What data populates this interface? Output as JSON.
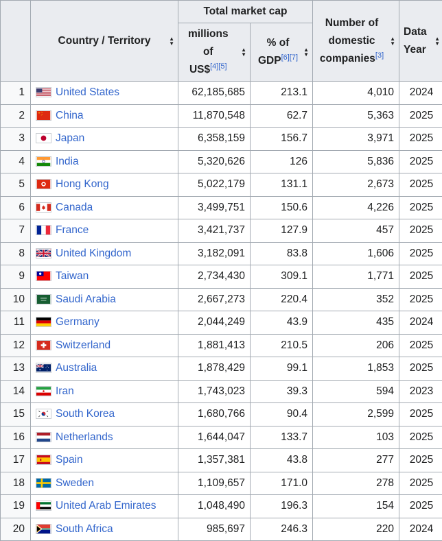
{
  "header": {
    "country": "Country / Territory",
    "market_cap_group": "Total market cap",
    "millions_line1": "millions",
    "millions_line2": "of",
    "millions_line3": "US$",
    "millions_refs": "[4][5]",
    "gdp_line1": "% of",
    "gdp_line2": "GDP",
    "gdp_refs": "[6][7]",
    "companies_line1": "Number of",
    "companies_line2": "domestic",
    "companies_line3": "companies",
    "companies_refs": "[3]",
    "year_line1": "Data",
    "year_line2": "Year",
    "sort_up": "▲",
    "sort_down": "▼"
  },
  "rows": [
    {
      "rank": "1",
      "country": "United States",
      "flag": "us",
      "cap": "62,185,685",
      "gdp": "213.1",
      "companies": "4,010",
      "year": "2024"
    },
    {
      "rank": "2",
      "country": "China",
      "flag": "cn",
      "cap": "11,870,548",
      "gdp": "62.7",
      "companies": "5,363",
      "year": "2025"
    },
    {
      "rank": "3",
      "country": "Japan",
      "flag": "jp",
      "cap": "6,358,159",
      "gdp": "156.7",
      "companies": "3,971",
      "year": "2025"
    },
    {
      "rank": "4",
      "country": "India",
      "flag": "in",
      "cap": "5,320,626",
      "gdp": "126",
      "companies": "5,836",
      "year": "2025"
    },
    {
      "rank": "5",
      "country": "Hong Kong",
      "flag": "hk",
      "cap": "5,022,179",
      "gdp": "131.1",
      "companies": "2,673",
      "year": "2025"
    },
    {
      "rank": "6",
      "country": "Canada",
      "flag": "ca",
      "cap": "3,499,751",
      "gdp": "150.6",
      "companies": "4,226",
      "year": "2025"
    },
    {
      "rank": "7",
      "country": "France",
      "flag": "fr",
      "cap": "3,421,737",
      "gdp": "127.9",
      "companies": "457",
      "year": "2025"
    },
    {
      "rank": "8",
      "country": "United Kingdom",
      "flag": "gb",
      "cap": "3,182,091",
      "gdp": "83.8",
      "companies": "1,606",
      "year": "2025"
    },
    {
      "rank": "9",
      "country": "Taiwan",
      "flag": "tw",
      "cap": "2,734,430",
      "gdp": "309.1",
      "companies": "1,771",
      "year": "2025"
    },
    {
      "rank": "10",
      "country": "Saudi Arabia",
      "flag": "sa",
      "cap": "2,667,273",
      "gdp": "220.4",
      "companies": "352",
      "year": "2025"
    },
    {
      "rank": "11",
      "country": "Germany",
      "flag": "de",
      "cap": "2,044,249",
      "gdp": "43.9",
      "companies": "435",
      "year": "2024"
    },
    {
      "rank": "12",
      "country": "Switzerland",
      "flag": "ch",
      "cap": "1,881,413",
      "gdp": "210.5",
      "companies": "206",
      "year": "2025"
    },
    {
      "rank": "13",
      "country": "Australia",
      "flag": "au",
      "cap": "1,878,429",
      "gdp": "99.1",
      "companies": "1,853",
      "year": "2025"
    },
    {
      "rank": "14",
      "country": "Iran",
      "flag": "ir",
      "cap": "1,743,023",
      "gdp": "39.3",
      "companies": "594",
      "year": "2023"
    },
    {
      "rank": "15",
      "country": "South Korea",
      "flag": "kr",
      "cap": "1,680,766",
      "gdp": "90.4",
      "companies": "2,599",
      "year": "2025"
    },
    {
      "rank": "16",
      "country": "Netherlands",
      "flag": "nl",
      "cap": "1,644,047",
      "gdp": "133.7",
      "companies": "103",
      "year": "2025"
    },
    {
      "rank": "17",
      "country": "Spain",
      "flag": "es",
      "cap": "1,357,381",
      "gdp": "43.8",
      "companies": "277",
      "year": "2025"
    },
    {
      "rank": "18",
      "country": "Sweden",
      "flag": "se",
      "cap": "1,109,657",
      "gdp": "171.0",
      "companies": "278",
      "year": "2025"
    },
    {
      "rank": "19",
      "country": "United Arab Emirates",
      "flag": "ae",
      "cap": "1,048,490",
      "gdp": "196.3",
      "companies": "154",
      "year": "2025"
    },
    {
      "rank": "20",
      "country": "South Africa",
      "flag": "za",
      "cap": "985,697",
      "gdp": "246.3",
      "companies": "220",
      "year": "2024"
    }
  ],
  "colors": {
    "link": "#3366cc",
    "header_bg": "#eaecf0",
    "border": "#a2a9b1",
    "rank_bg": "#f8f9fa"
  }
}
